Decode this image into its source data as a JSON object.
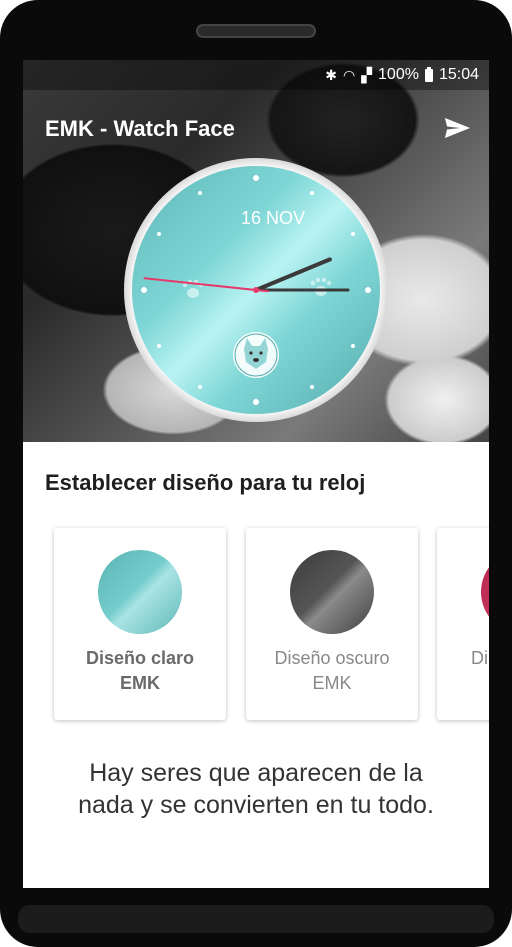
{
  "app": {
    "title": "EMK - Watch Face"
  },
  "status_bar": {
    "battery": "100%",
    "time": "15:04"
  },
  "clock": {
    "date": "16 NOV",
    "hour": 2,
    "minute": 15,
    "second": 46,
    "face_color": "#6cc5c5",
    "rim_color": "#ffffff"
  },
  "section": {
    "title": "Establecer diseño para tu reloj"
  },
  "designs": [
    {
      "label_line1": "Diseño claro",
      "label_line2": "EMK",
      "color": "#6cc3c3",
      "selected": true
    },
    {
      "label_line1": "Diseño oscuro",
      "label_line2": "EMK",
      "color": "#505050",
      "selected": false
    },
    {
      "label_line1": "Di",
      "label_line2": "",
      "color": "#c8325a",
      "selected": false
    }
  ],
  "quote": {
    "line1": "Hay seres que aparecen de la",
    "line2": "nada y se convierten en tu todo."
  },
  "colors": {
    "accent": "#6cc5c5",
    "second_hand": "#e53a6a",
    "hand": "#333333"
  },
  "icons": [
    "send-icon",
    "bluetooth-icon",
    "wifi-icon",
    "signal-icon",
    "battery-icon",
    "paw-icon",
    "dog-logo-icon"
  ]
}
